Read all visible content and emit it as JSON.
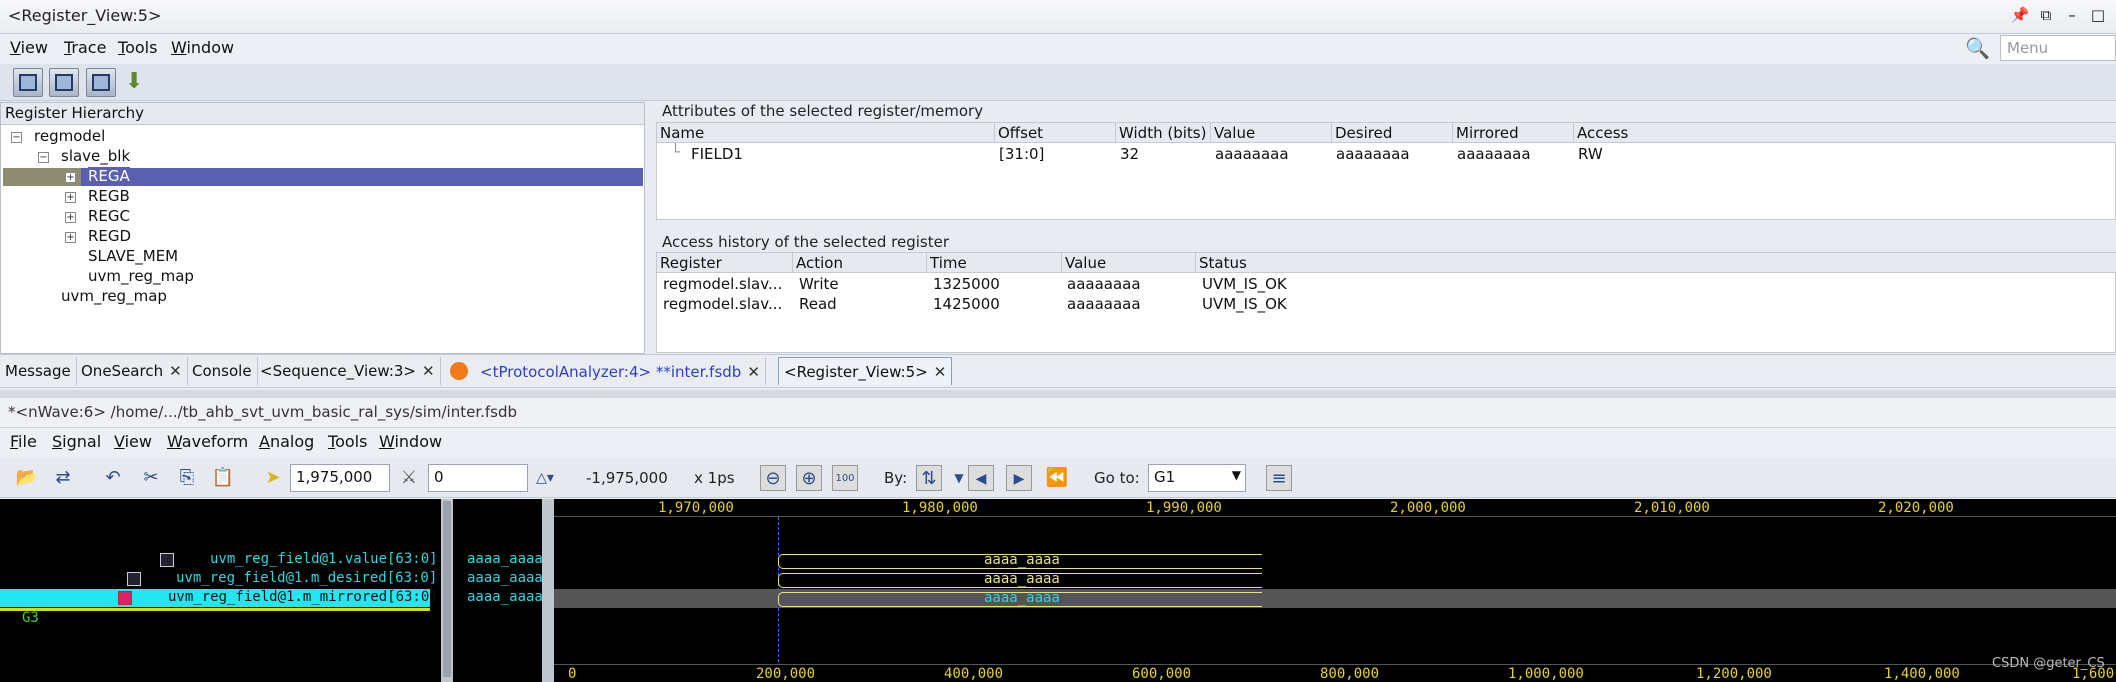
{
  "window": {
    "title": "<Register_View:5>"
  },
  "menu": [
    "View",
    "Trace",
    "Tools",
    "Window"
  ],
  "search": {
    "placeholder": "Menu"
  },
  "hierarchy": {
    "header": "Register Hierarchy",
    "nodes": [
      "regmodel",
      "slave_blk",
      "REGA",
      "REGB",
      "REGC",
      "REGD",
      "SLAVE_MEM",
      "uvm_reg_map",
      "uvm_reg_map"
    ]
  },
  "attributes": {
    "label": "Attributes of the selected register/memory",
    "columns": [
      "Name",
      "Offset",
      "Width (bits)",
      "Value",
      "Desired",
      "Mirrored",
      "Access"
    ],
    "row": [
      "FIELD1",
      "[31:0]",
      "32",
      "aaaaaaaa",
      "aaaaaaaa",
      "aaaaaaaa",
      "RW"
    ]
  },
  "history": {
    "label": "Access history of the selected register",
    "columns": [
      "Register",
      "Action",
      "Time",
      "Value",
      "Status"
    ],
    "rows": [
      [
        "regmodel.slav...",
        "Write",
        "1325000",
        "aaaaaaaa",
        "UVM_IS_OK"
      ],
      [
        "regmodel.slav...",
        "Read",
        "1425000",
        "aaaaaaaa",
        "UVM_IS_OK"
      ]
    ]
  },
  "tabs": [
    "Message",
    "OneSearch",
    "Console",
    "<Sequence_View:3>",
    "<tProtocolAnalyzer:4> **inter.fsdb",
    "<Register_View:5>"
  ],
  "nwave": {
    "title": "*<nWave:6> /home/.../tb_ahb_svt_uvm_basic_ral_sys/sim/inter.fsdb",
    "menu": [
      "File",
      "Signal",
      "View",
      "Waveform",
      "Analog",
      "Tools",
      "Window"
    ],
    "cursor_time": "1,975,000",
    "marker_time": "0",
    "delta": "-1,975,000",
    "unit": "x 1ps",
    "by_label": "By:",
    "goto_label": "Go to:",
    "goto_value": "G1",
    "signals": [
      "uvm_reg_field@1.value[63:0]",
      "uvm_reg_field@1.m_desired[63:0]",
      "uvm_reg_field@1.m_mirrored[63:0]"
    ],
    "group": "G3",
    "values": [
      "aaaa_aaaa",
      "aaaa_aaaa",
      "aaaa_aaaa"
    ],
    "top_ticks": [
      "1,970,000",
      "1,980,000",
      "1,990,000",
      "2,000,000",
      "2,010,000",
      "2,020,000"
    ],
    "bottom_ticks": [
      "0",
      "200,000",
      "400,000",
      "600,000",
      "800,000",
      "1,000,000",
      "1,200,000",
      "1,400,000",
      "1,600"
    ],
    "watermark": "CSDN @geter_CS"
  }
}
